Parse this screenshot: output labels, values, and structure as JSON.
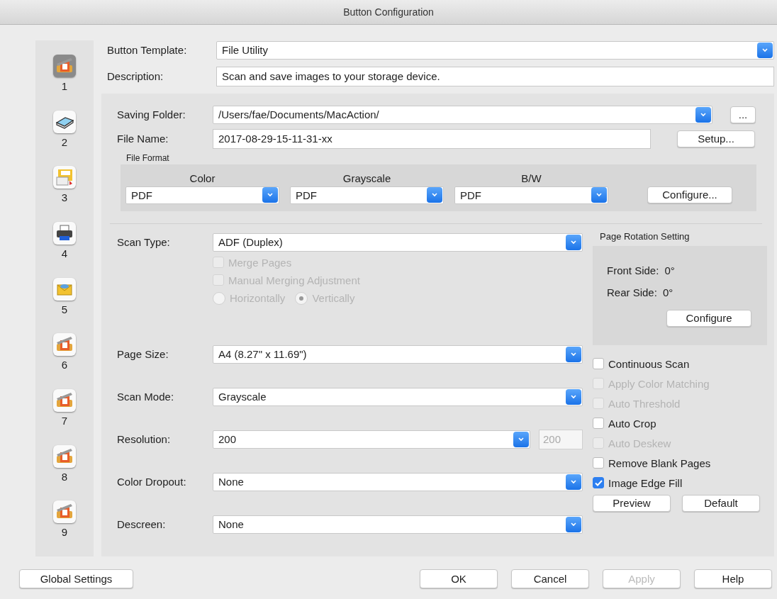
{
  "window": {
    "title": "Button Configuration"
  },
  "sidebar": {
    "items": [
      {
        "label": "1",
        "kind": "scanner",
        "selected": true
      },
      {
        "label": "2",
        "kind": "flatbed",
        "selected": false
      },
      {
        "label": "3",
        "kind": "ocr",
        "selected": false
      },
      {
        "label": "4",
        "kind": "printer",
        "selected": false
      },
      {
        "label": "5",
        "kind": "mail",
        "selected": false
      },
      {
        "label": "6",
        "kind": "scanner",
        "selected": false
      },
      {
        "label": "7",
        "kind": "scanner",
        "selected": false
      },
      {
        "label": "8",
        "kind": "scanner",
        "selected": false
      },
      {
        "label": "9",
        "kind": "scanner",
        "selected": false
      }
    ]
  },
  "button_template": {
    "label": "Button Template:",
    "value": "File Utility"
  },
  "description": {
    "label": "Description:",
    "value": "Scan and save images to your storage device."
  },
  "saving_folder": {
    "label": "Saving Folder:",
    "value": "/Users/fae/Documents/MacAction/",
    "button": "..."
  },
  "file_name": {
    "label": "File Name:",
    "value": "2017-08-29-15-11-31-xx",
    "button": "Setup..."
  },
  "file_format": {
    "title": "File Format",
    "columns": [
      {
        "label": "Color",
        "value": "PDF"
      },
      {
        "label": "Grayscale",
        "value": "PDF"
      },
      {
        "label": "B/W",
        "value": "PDF"
      }
    ],
    "button": "Configure..."
  },
  "scan_type": {
    "label": "Scan Type:",
    "value": "ADF (Duplex)",
    "checkboxes": [
      {
        "label": "Merge Pages",
        "checked": false,
        "disabled": true
      },
      {
        "label": "Manual Merging Adjustment",
        "checked": false,
        "disabled": true
      }
    ],
    "radios": [
      {
        "label": "Horizontally",
        "selected": false,
        "disabled": true
      },
      {
        "label": "Vertically",
        "selected": true,
        "disabled": true
      }
    ]
  },
  "fields": [
    {
      "label": "Page Size:",
      "value": "A4 (8.27\" x 11.69\")"
    },
    {
      "label": "Scan Mode:",
      "value": "Grayscale"
    },
    {
      "label": "Resolution:",
      "value": "200",
      "side_value": "200"
    },
    {
      "label": "Color Dropout:",
      "value": "None"
    },
    {
      "label": "Descreen:",
      "value": "None"
    }
  ],
  "page_rotation": {
    "title": "Page Rotation Setting",
    "rows": [
      {
        "label": "Front Side:",
        "value": "0°"
      },
      {
        "label": "Rear Side:",
        "value": "0°"
      }
    ],
    "button": "Configure"
  },
  "options": [
    {
      "label": "Continuous Scan",
      "checked": false,
      "disabled": false
    },
    {
      "label": "Apply Color Matching",
      "checked": false,
      "disabled": true
    },
    {
      "label": "Auto Threshold",
      "checked": false,
      "disabled": true
    },
    {
      "label": "Auto Crop",
      "checked": false,
      "disabled": false
    },
    {
      "label": "Auto Deskew",
      "checked": false,
      "disabled": true
    },
    {
      "label": "Remove Blank Pages",
      "checked": false,
      "disabled": false
    },
    {
      "label": "Image Edge Fill",
      "checked": true,
      "disabled": false
    }
  ],
  "panel_buttons": [
    "Preview",
    "Default"
  ],
  "footer": {
    "left_button": "Global Settings",
    "buttons": [
      {
        "label": "OK",
        "disabled": false
      },
      {
        "label": "Cancel",
        "disabled": false
      },
      {
        "label": "Apply",
        "disabled": true
      },
      {
        "label": "Help",
        "disabled": false
      }
    ]
  }
}
